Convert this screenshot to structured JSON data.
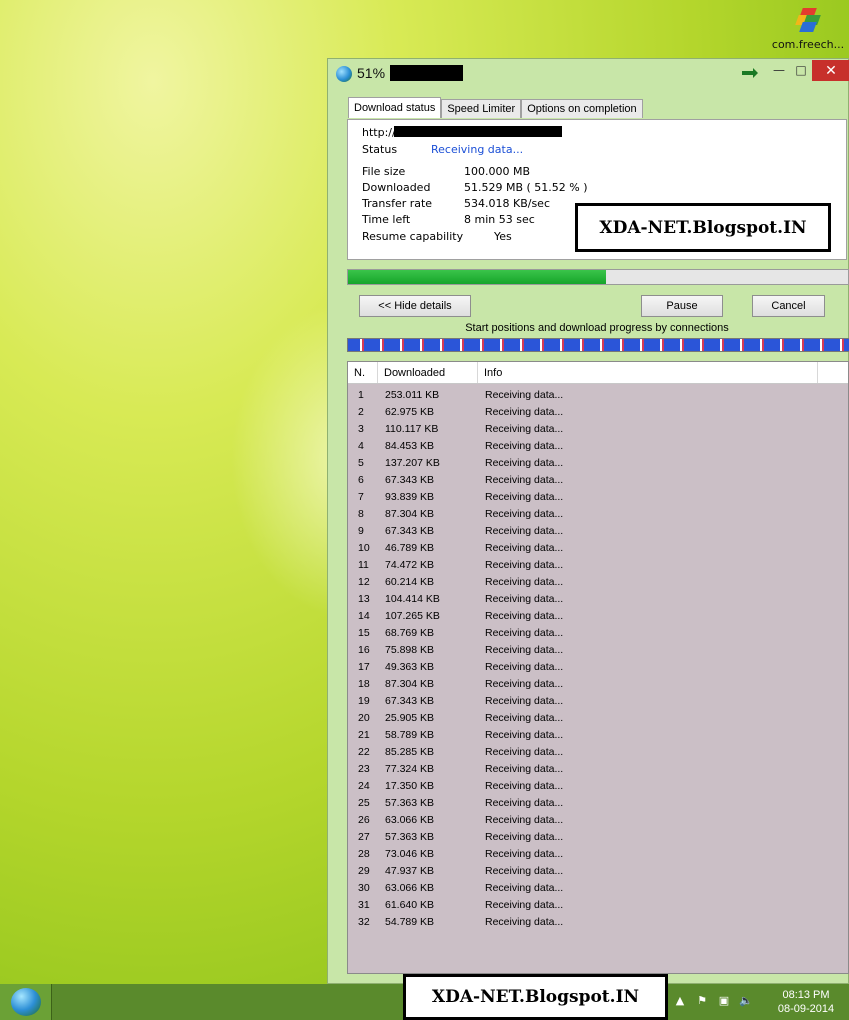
{
  "desktop": {
    "icon_label": "com.freech..."
  },
  "window": {
    "title": "51%",
    "tabs": [
      "Download status",
      "Speed Limiter",
      "Options on completion"
    ],
    "url_label": "http://",
    "details": {
      "status_label": "Status",
      "status_value": "Receiving data...",
      "file_size_label": "File size",
      "file_size_value": "100.000  MB",
      "downloaded_label": "Downloaded",
      "downloaded_value": "51.529  MB  ( 51.52 % )",
      "transfer_rate_label": "Transfer rate",
      "transfer_rate_value": "534.018  KB/sec",
      "time_left_label": "Time left",
      "time_left_value": "8 min 53 sec",
      "resume_label": "Resume capability",
      "resume_value": "Yes"
    },
    "progress_fraction": 0.5152,
    "buttons": {
      "hide_details": "<< Hide details",
      "pause": "Pause",
      "cancel": "Cancel"
    },
    "connections_caption": "Start positions and download progress by connections",
    "table": {
      "headers": [
        "N.",
        "Downloaded",
        "Info"
      ],
      "rows": [
        [
          "1",
          "253.011  KB",
          "Receiving data..."
        ],
        [
          "2",
          "62.975  KB",
          "Receiving data..."
        ],
        [
          "3",
          "110.117  KB",
          "Receiving data..."
        ],
        [
          "4",
          "84.453  KB",
          "Receiving data..."
        ],
        [
          "5",
          "137.207  KB",
          "Receiving data..."
        ],
        [
          "6",
          "67.343  KB",
          "Receiving data..."
        ],
        [
          "7",
          "93.839  KB",
          "Receiving data..."
        ],
        [
          "8",
          "87.304  KB",
          "Receiving data..."
        ],
        [
          "9",
          "67.343  KB",
          "Receiving data..."
        ],
        [
          "10",
          "46.789  KB",
          "Receiving data..."
        ],
        [
          "11",
          "74.472  KB",
          "Receiving data..."
        ],
        [
          "12",
          "60.214  KB",
          "Receiving data..."
        ],
        [
          "13",
          "104.414  KB",
          "Receiving data..."
        ],
        [
          "14",
          "107.265  KB",
          "Receiving data..."
        ],
        [
          "15",
          "68.769  KB",
          "Receiving data..."
        ],
        [
          "16",
          "75.898  KB",
          "Receiving data..."
        ],
        [
          "17",
          "49.363  KB",
          "Receiving data..."
        ],
        [
          "18",
          "87.304  KB",
          "Receiving data..."
        ],
        [
          "19",
          "67.343  KB",
          "Receiving data..."
        ],
        [
          "20",
          "25.905  KB",
          "Receiving data..."
        ],
        [
          "21",
          "58.789  KB",
          "Receiving data..."
        ],
        [
          "22",
          "85.285  KB",
          "Receiving data..."
        ],
        [
          "23",
          "77.324  KB",
          "Receiving data..."
        ],
        [
          "24",
          "17.350  KB",
          "Receiving data..."
        ],
        [
          "25",
          "57.363  KB",
          "Receiving data..."
        ],
        [
          "26",
          "63.066  KB",
          "Receiving data..."
        ],
        [
          "27",
          "57.363  KB",
          "Receiving data..."
        ],
        [
          "28",
          "73.046  KB",
          "Receiving data..."
        ],
        [
          "29",
          "47.937  KB",
          "Receiving data..."
        ],
        [
          "30",
          "63.066  KB",
          "Receiving data..."
        ],
        [
          "31",
          "61.640  KB",
          "Receiving data..."
        ],
        [
          "32",
          "54.789  KB",
          "Receiving data..."
        ]
      ]
    }
  },
  "watermark": "XDA-NET.Blogspot.IN",
  "taskbar": {
    "time": "08:13 PM",
    "date": "08-09-2014"
  },
  "colors": {
    "progress": "#16a52a",
    "status_text": "#1b4fd6",
    "close_button": "#c7302b",
    "table_bg": "#cbbfc6"
  }
}
